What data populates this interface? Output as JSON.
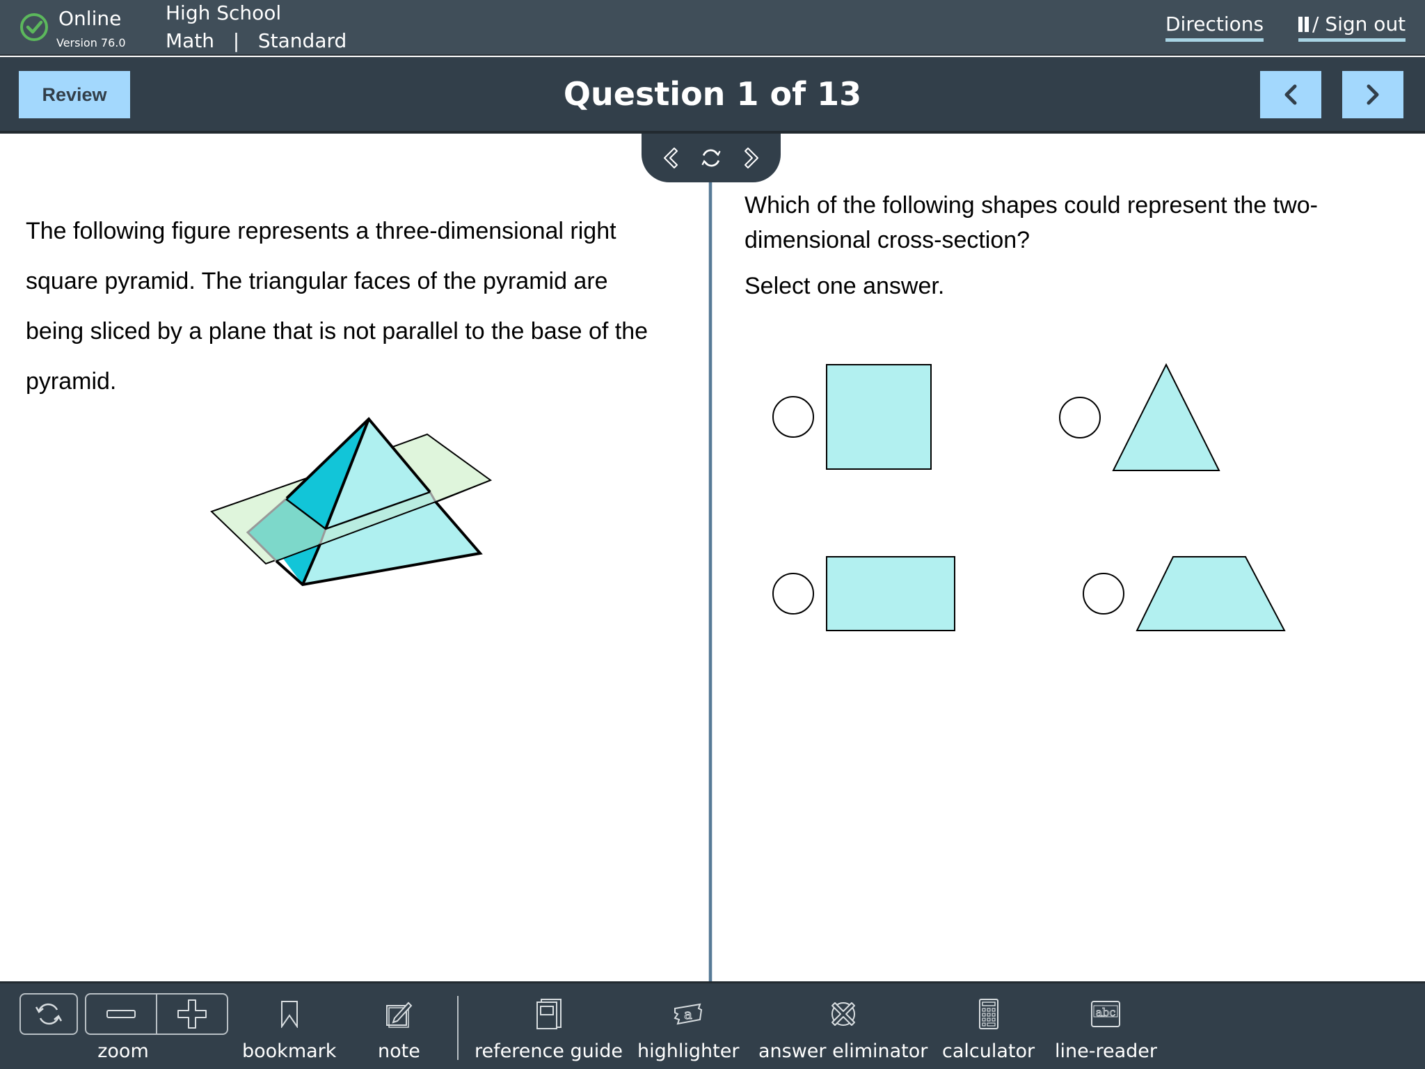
{
  "status": {
    "connection": "Online",
    "version": "Version 76.0",
    "check_color": "#5cb85c"
  },
  "course": {
    "level": "High School",
    "subject": "Math",
    "separator": "|",
    "mode": "Standard"
  },
  "top_links": {
    "directions": "Directions",
    "signout": "/ Sign out"
  },
  "header": {
    "review_label": "Review",
    "title": "Question 1 of 13",
    "prev_icon": "chevron-left-icon",
    "next_icon": "chevron-right-icon"
  },
  "pane_controls": {
    "collapse_left": "double-chevron-left-icon",
    "reset": "refresh-icon",
    "collapse_right": "double-chevron-right-icon"
  },
  "passage": {
    "text": "The following figure represents a three-dimensional right square pyramid. The triangular faces of the pyramid are being sliced by a plane that is not parallel to the base of the pyramid.",
    "figure_label": "right square pyramid sliced by an oblique plane"
  },
  "question": {
    "prompt": "Which of the following shapes could represent the two-dimensional cross-section?",
    "instruction": "Select one answer.",
    "options": [
      {
        "id": "A",
        "shape": "square",
        "selected": false
      },
      {
        "id": "B",
        "shape": "triangle",
        "selected": false
      },
      {
        "id": "C",
        "shape": "rectangle",
        "selected": false
      },
      {
        "id": "D",
        "shape": "trapezoid",
        "selected": false
      }
    ],
    "shape_fill": "#b2f0f0"
  },
  "toolbar": {
    "zoom_label": "zoom",
    "tools": [
      {
        "label": "bookmark",
        "icon": "bookmark-icon"
      },
      {
        "label": "note",
        "icon": "note-icon"
      },
      {
        "label": "reference guide",
        "icon": "book-icon"
      },
      {
        "label": "highlighter",
        "icon": "highlighter-icon"
      },
      {
        "label": "answer eliminator",
        "icon": "answer-eliminator-icon"
      },
      {
        "label": "calculator",
        "icon": "calculator-icon"
      },
      {
        "label": "line-reader",
        "icon": "line-reader-icon"
      }
    ]
  }
}
